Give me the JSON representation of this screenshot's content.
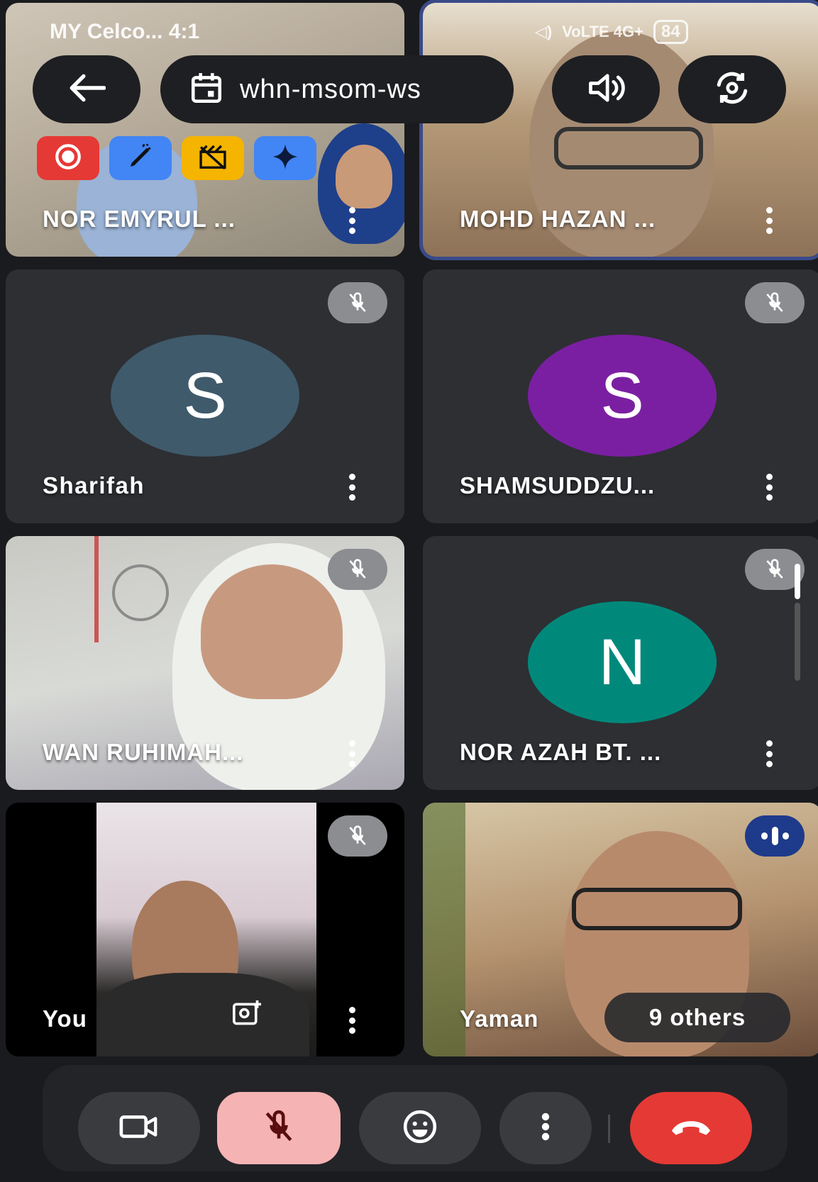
{
  "status_bar": {
    "carrier_time": "MY Celco... 4:1",
    "network": "VoLTE 4G+",
    "battery": "84"
  },
  "top_bar": {
    "meeting_code": "whn-msom-ws"
  },
  "participants": [
    {
      "name": "NOR EMYRUL ..."
    },
    {
      "name": "MOHD HAZAN ..."
    },
    {
      "name": "Sharifah",
      "initial": "S"
    },
    {
      "name": "SHAMSUDDZU...",
      "initial": "S"
    },
    {
      "name": "WAN RUHIMAH..."
    },
    {
      "name": "NOR AZAH BT. ...",
      "initial": "N"
    },
    {
      "name": "You"
    },
    {
      "name": "Yaman"
    }
  ],
  "others": "9 others",
  "colors": {
    "avatar_sharifah": "#3f5a6b",
    "avatar_shamsuddzu": "#7b1fa2",
    "avatar_nor_azah": "#00897b",
    "record": "#e53935",
    "annotate": "#4285f4",
    "effects": "#f4b400",
    "gemini": "#4285f4",
    "hangup": "#e53935",
    "mic_off_bg": "#f5b3b3",
    "speaking": "#1e3a8a"
  },
  "icons": {
    "back": "arrow-left-icon",
    "calendar": "calendar-icon",
    "speaker": "speaker-icon",
    "switch_camera": "switch-camera-icon",
    "record": "record-icon",
    "annotate": "pencil-icon",
    "effects": "effects-icon",
    "gemini": "sparkle-icon",
    "mic_off": "mic-off-icon",
    "camera": "video-camera-icon",
    "emoji": "emoji-icon",
    "more": "more-vert-icon",
    "hangup": "hangup-icon"
  }
}
